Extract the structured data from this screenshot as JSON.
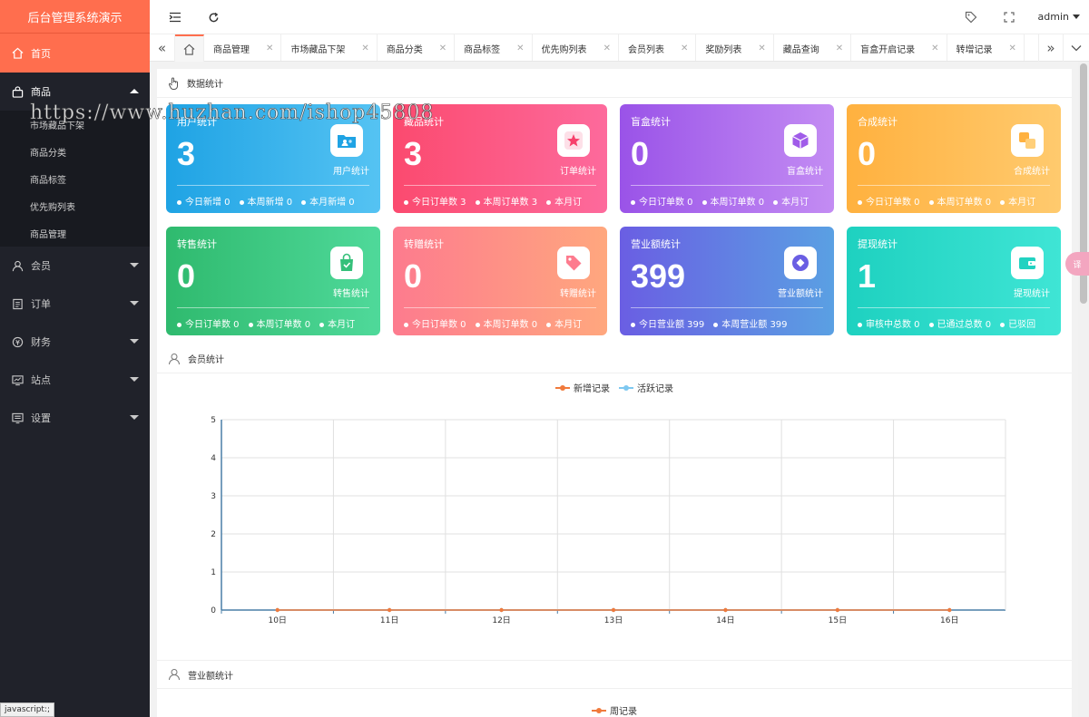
{
  "app": {
    "title": "后台管理系统演示"
  },
  "sidebar": {
    "home": "首页",
    "groups": [
      {
        "label": "商品",
        "expanded": true,
        "items": [
          "市场藏品下架",
          "商品分类",
          "商品标签",
          "优先购列表",
          "商品管理"
        ]
      },
      {
        "label": "会员"
      },
      {
        "label": "订单"
      },
      {
        "label": "财务"
      },
      {
        "label": "站点"
      },
      {
        "label": "设置"
      }
    ]
  },
  "topbar": {
    "user": "admin"
  },
  "tabs": [
    "商品管理",
    "市场藏品下架",
    "商品分类",
    "商品标签",
    "优先购列表",
    "会员列表",
    "奖励列表",
    "藏品查询",
    "盲盒开启记录",
    "转增记录"
  ],
  "sections": {
    "data_stats": "数据统计",
    "member_stats": "会员统计",
    "revenue_stats": "营业额统计"
  },
  "cards": [
    {
      "title": "用户统计",
      "value": "3",
      "label": "用户统计",
      "stats": [
        "今日新增 0",
        "本周新增 0",
        "本月新增 0"
      ]
    },
    {
      "title": "藏品统计",
      "value": "3",
      "label": "订单统计",
      "stats": [
        "今日订单数 3",
        "本周订单数 3",
        "本月订"
      ]
    },
    {
      "title": "盲盒统计",
      "value": "0",
      "label": "盲盒统计",
      "stats": [
        "今日订单数 0",
        "本周订单数 0",
        "本月订"
      ]
    },
    {
      "title": "合成统计",
      "value": "0",
      "label": "合成统计",
      "stats": [
        "今日订单数 0",
        "本周订单数 0",
        "本月订"
      ]
    },
    {
      "title": "转售统计",
      "value": "0",
      "label": "转售统计",
      "stats": [
        "今日订单数 0",
        "本周订单数 0",
        "本月订"
      ]
    },
    {
      "title": "转赠统计",
      "value": "0",
      "label": "转赠统计",
      "stats": [
        "今日订单数 0",
        "本周订单数 0",
        "本月订"
      ]
    },
    {
      "title": "营业额统计",
      "value": "399",
      "label": "营业额统计",
      "stats": [
        "今日营业额 399",
        "本周营业额 399"
      ]
    },
    {
      "title": "提现统计",
      "value": "1",
      "label": "提现统计",
      "stats": [
        "审核中总数 0",
        "已通过总数 0",
        "已驳回"
      ]
    }
  ],
  "colors": {
    "accent": "#ff6e4e",
    "new_series": "#f07a3c",
    "active_series": "#7ec8f0"
  },
  "status_text": "javascript:;",
  "watermark": "https://www.huzhan.com/ishop45808",
  "float_button": "译",
  "chart_data": [
    {
      "type": "line",
      "categories": [
        "10日",
        "11日",
        "12日",
        "13日",
        "14日",
        "15日",
        "16日"
      ],
      "series": [
        {
          "name": "新增记录",
          "values": [
            0,
            0,
            0,
            0,
            0,
            0,
            0
          ]
        },
        {
          "name": "活跃记录",
          "values": [
            0,
            0,
            0,
            0,
            0,
            0,
            0
          ]
        }
      ],
      "ylim": [
        0,
        5
      ],
      "yticks": [
        0,
        1,
        2,
        3,
        4,
        5
      ],
      "grid": true,
      "legend": "top-center"
    },
    {
      "type": "line",
      "series": [
        {
          "name": "周记录",
          "values": []
        }
      ],
      "legend": "top-center"
    }
  ]
}
